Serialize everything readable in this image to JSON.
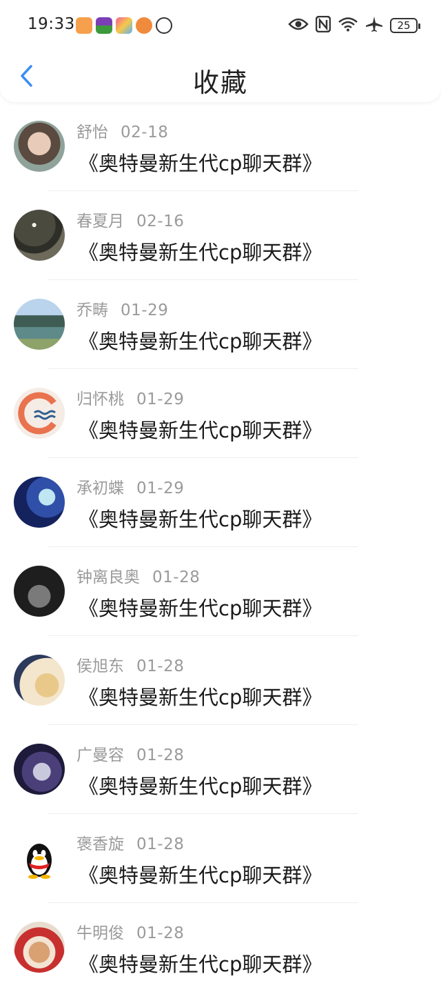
{
  "status_bar": {
    "time": "19:33",
    "battery": "25",
    "icons": [
      "eye-icon",
      "nfc-icon",
      "wifi-icon",
      "airplane-icon"
    ]
  },
  "header": {
    "title": "收藏",
    "back_icon": "chevron-left-icon"
  },
  "items": [
    {
      "nickname": " 舒怡",
      "date": "02-18",
      "title": "《奥特曼新生代cp聊天群》"
    },
    {
      "nickname": "春夏月",
      "date": "02-16",
      "title": "《奥特曼新生代cp聊天群》"
    },
    {
      "nickname": "乔畴",
      "date": "01-29",
      "title": "《奥特曼新生代cp聊天群》"
    },
    {
      "nickname": "归怀桃",
      "date": "01-29",
      "title": "《奥特曼新生代cp聊天群》"
    },
    {
      "nickname": "承初蝶",
      "date": "01-29",
      "title": "《奥特曼新生代cp聊天群》"
    },
    {
      "nickname": "钟离良奥",
      "date": "01-28",
      "title": "《奥特曼新生代cp聊天群》"
    },
    {
      "nickname": "侯旭东",
      "date": "01-28",
      "title": "《奥特曼新生代cp聊天群》"
    },
    {
      "nickname": "广曼容",
      "date": "01-28",
      "title": "《奥特曼新生代cp聊天群》"
    },
    {
      "nickname": "褒香旋",
      "date": "01-28",
      "title": "《奥特曼新生代cp聊天群》"
    },
    {
      "nickname": "牛明俊",
      "date": "01-28",
      "title": "《奥特曼新生代cp聊天群》"
    }
  ],
  "colors": {
    "accent": "#3b8ff0",
    "meta_text": "#9a9a9a",
    "title_text": "#1a1a1a"
  }
}
